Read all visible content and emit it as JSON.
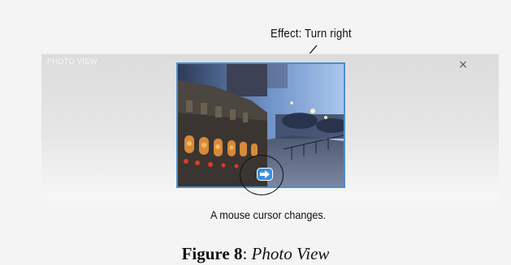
{
  "annotations": {
    "effect": "Effect: Turn right",
    "cursor_note": "A mouse cursor changes."
  },
  "viewer": {
    "title": "PHOTO VIEW",
    "close_label": "×",
    "accent_color": "#4b8fc9",
    "cursor_icon": "arrow-right-icon"
  },
  "caption": {
    "label": "Figure 8",
    "separator": ": ",
    "title": "Photo View"
  }
}
